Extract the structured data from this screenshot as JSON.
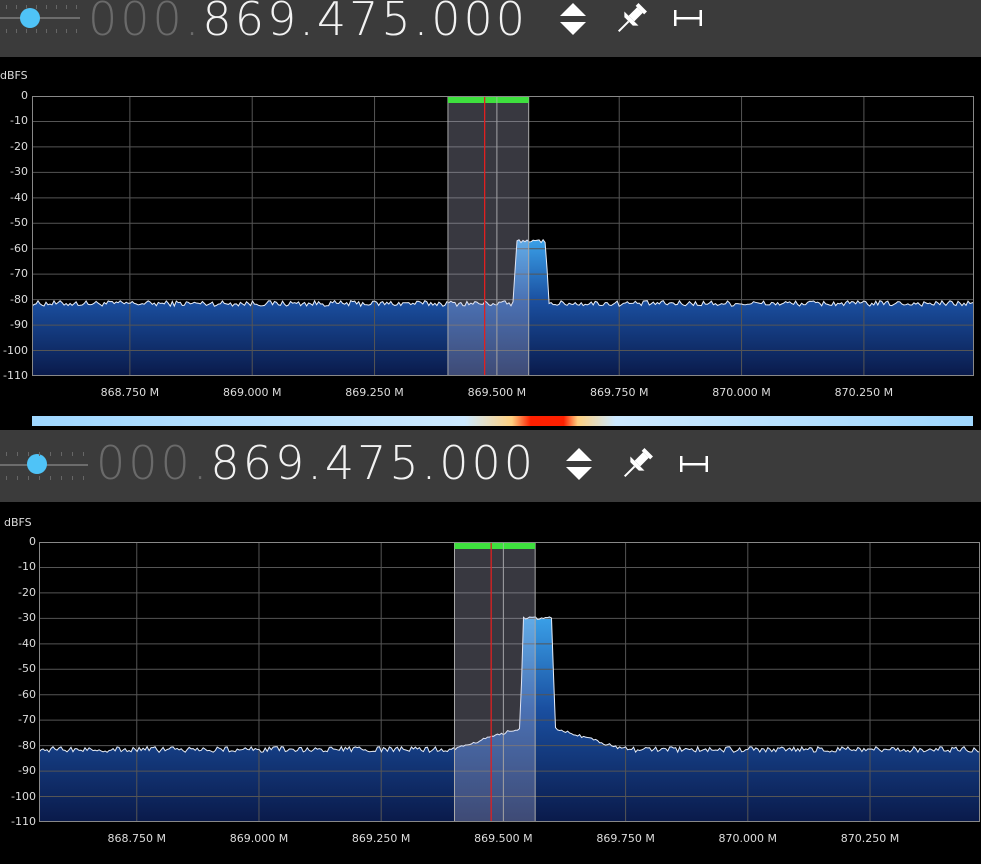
{
  "panels": [
    {
      "frequency": {
        "prefix": "000.",
        "main": "869.475.000"
      },
      "axis_unit": "dBFS",
      "y_ticks": [
        "0",
        "-10",
        "-20",
        "-30",
        "-40",
        "-50",
        "-60",
        "-70",
        "-80",
        "-90",
        "-100",
        "-110"
      ],
      "x_ticks": [
        "868.750 M",
        "869.000 M",
        "869.250 M",
        "869.500 M",
        "869.750 M",
        "870.000 M",
        "870.250 M"
      ],
      "chart_data": {
        "type": "area",
        "ylabel": "dBFS",
        "ylim": [
          -110,
          0
        ],
        "xlim_mhz": [
          868.55,
          870.475
        ],
        "noise_floor_db": -81.5,
        "signal": {
          "start_mhz": 869.54,
          "end_mhz": 869.6,
          "peak_db": -57
        },
        "demod_band_mhz": [
          869.4,
          869.565
        ],
        "center_mhz": 869.475,
        "grid": true
      }
    },
    {
      "frequency": {
        "prefix": "000.",
        "main": "869.475.000"
      },
      "axis_unit": "dBFS",
      "y_ticks": [
        "0",
        "-10",
        "-20",
        "-30",
        "-40",
        "-50",
        "-60",
        "-70",
        "-80",
        "-90",
        "-100",
        "-110"
      ],
      "x_ticks": [
        "868.750 M",
        "869.000 M",
        "869.250 M",
        "869.500 M",
        "869.750 M",
        "870.000 M",
        "870.250 M"
      ],
      "chart_data": {
        "type": "area",
        "ylabel": "dBFS",
        "ylim": [
          -110,
          0
        ],
        "xlim_mhz": [
          868.55,
          870.475
        ],
        "noise_floor_db": -81.5,
        "signal": {
          "start_mhz": 869.54,
          "end_mhz": 869.6,
          "peak_db": -30
        },
        "demod_band_mhz": [
          869.4,
          869.565
        ],
        "center_mhz": 869.475,
        "grid": true
      }
    }
  ],
  "colors": {
    "accent_bar": "#3ee03e",
    "cursor": "#e02020",
    "knob": "#4fc3f7"
  }
}
